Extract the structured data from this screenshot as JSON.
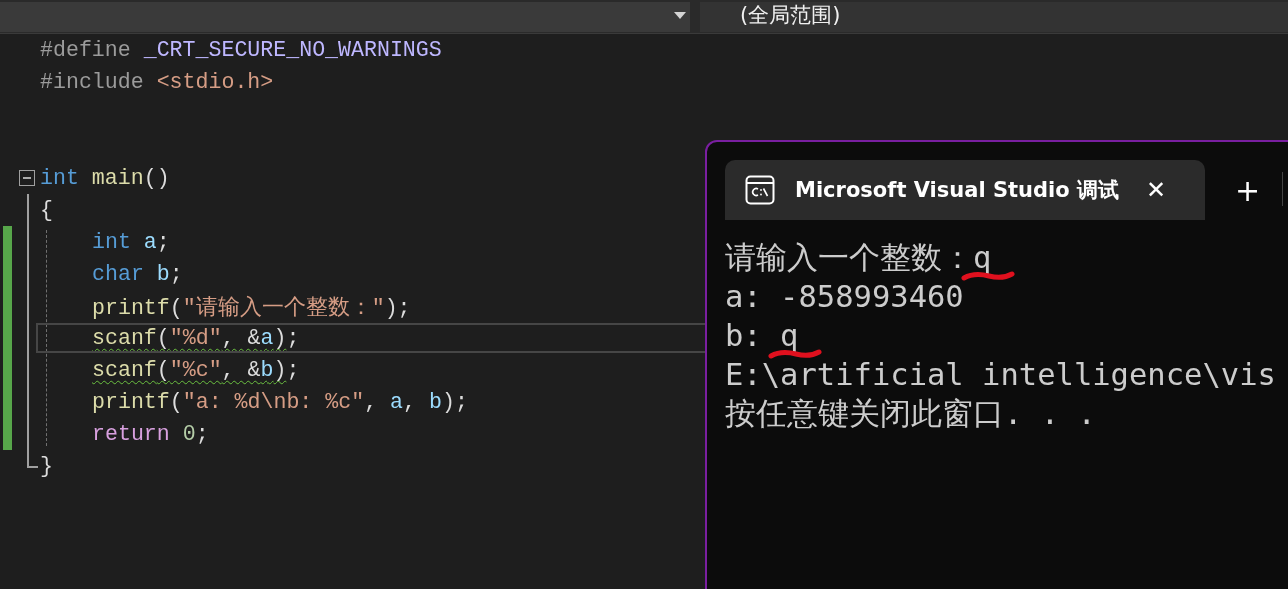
{
  "navigation_bar": {
    "scope_dropdown": {
      "value": "(全局范围)"
    }
  },
  "editor": {
    "preamble": [
      {
        "tokens": [
          {
            "kind": "preproc",
            "text": "#define "
          },
          {
            "kind": "macro",
            "text": "_CRT_SECURE_NO_WARNINGS"
          }
        ]
      },
      {
        "tokens": [
          {
            "kind": "preproc",
            "text": "#include "
          },
          {
            "kind": "string",
            "text": "<stdio.h>"
          }
        ]
      }
    ],
    "function": {
      "tokens": [
        {
          "kind": "keyword",
          "text": "int "
        },
        {
          "kind": "function",
          "text": "main"
        },
        {
          "kind": "punct",
          "text": "()"
        }
      ],
      "expanded": true,
      "block": {
        "open": "{",
        "close": "}",
        "children": [
          {
            "changed": true,
            "current": false,
            "tokens": [
              {
                "kind": "keyword",
                "text": "int "
              },
              {
                "kind": "variable",
                "text": "a"
              },
              {
                "kind": "punct",
                "text": ";"
              }
            ]
          },
          {
            "changed": true,
            "current": false,
            "tokens": [
              {
                "kind": "keyword",
                "text": "char "
              },
              {
                "kind": "variable",
                "text": "b"
              },
              {
                "kind": "punct",
                "text": ";"
              }
            ]
          },
          {
            "changed": true,
            "current": false,
            "tokens": [
              {
                "kind": "function",
                "text": "printf"
              },
              {
                "kind": "punct",
                "text": "("
              },
              {
                "kind": "string",
                "text": "\"请输入一个整数：\""
              },
              {
                "kind": "punct",
                "text": ");"
              }
            ]
          },
          {
            "changed": true,
            "current": true,
            "tokens": [
              {
                "kind": "warning",
                "children": [
                  {
                    "kind": "function",
                    "text": "scanf"
                  },
                  {
                    "kind": "punct",
                    "text": "("
                  },
                  {
                    "kind": "string",
                    "text": "\"%d\""
                  },
                  {
                    "kind": "punct",
                    "text": ", &"
                  },
                  {
                    "kind": "variable",
                    "text": "a"
                  },
                  {
                    "kind": "punct",
                    "text": ")"
                  }
                ]
              },
              {
                "kind": "punct",
                "text": ";"
              }
            ]
          },
          {
            "changed": true,
            "current": false,
            "tokens": [
              {
                "kind": "warning",
                "children": [
                  {
                    "kind": "function",
                    "text": "scanf"
                  },
                  {
                    "kind": "punct",
                    "text": "("
                  },
                  {
                    "kind": "string",
                    "text": "\"%c\""
                  },
                  {
                    "kind": "punct",
                    "text": ", &"
                  },
                  {
                    "kind": "variable",
                    "text": "b"
                  },
                  {
                    "kind": "punct",
                    "text": ")"
                  }
                ]
              },
              {
                "kind": "punct",
                "text": ";"
              }
            ]
          },
          {
            "changed": true,
            "current": false,
            "tokens": [
              {
                "kind": "function",
                "text": "printf"
              },
              {
                "kind": "punct",
                "text": "("
              },
              {
                "kind": "string",
                "text": "\"a: %d\\nb: %c\""
              },
              {
                "kind": "punct",
                "text": ", "
              },
              {
                "kind": "variable",
                "text": "a"
              },
              {
                "kind": "punct",
                "text": ", "
              },
              {
                "kind": "variable",
                "text": "b"
              },
              {
                "kind": "punct",
                "text": ");"
              }
            ]
          },
          {
            "changed": true,
            "current": false,
            "tokens": [
              {
                "kind": "control",
                "text": "return "
              },
              {
                "kind": "number",
                "text": "0"
              },
              {
                "kind": "punct",
                "text": ";"
              }
            ]
          }
        ]
      }
    }
  },
  "console": {
    "tab": {
      "title": "Microsoft Visual Studio 调试",
      "selected": true,
      "close": "✕"
    },
    "new_tab": "+",
    "lines": [
      [
        {
          "text": "请输入一个整数："
        },
        {
          "text": "q",
          "marked": true
        }
      ],
      [
        {
          "text": "a: -858993460"
        }
      ],
      [
        {
          "text": "b: "
        },
        {
          "text": "q",
          "marked": true
        }
      ],
      [
        {
          "text": "E:\\artificial intelligence\\vis"
        }
      ],
      [
        {
          "text": "按任意键关闭此窗口. . ."
        }
      ]
    ]
  }
}
